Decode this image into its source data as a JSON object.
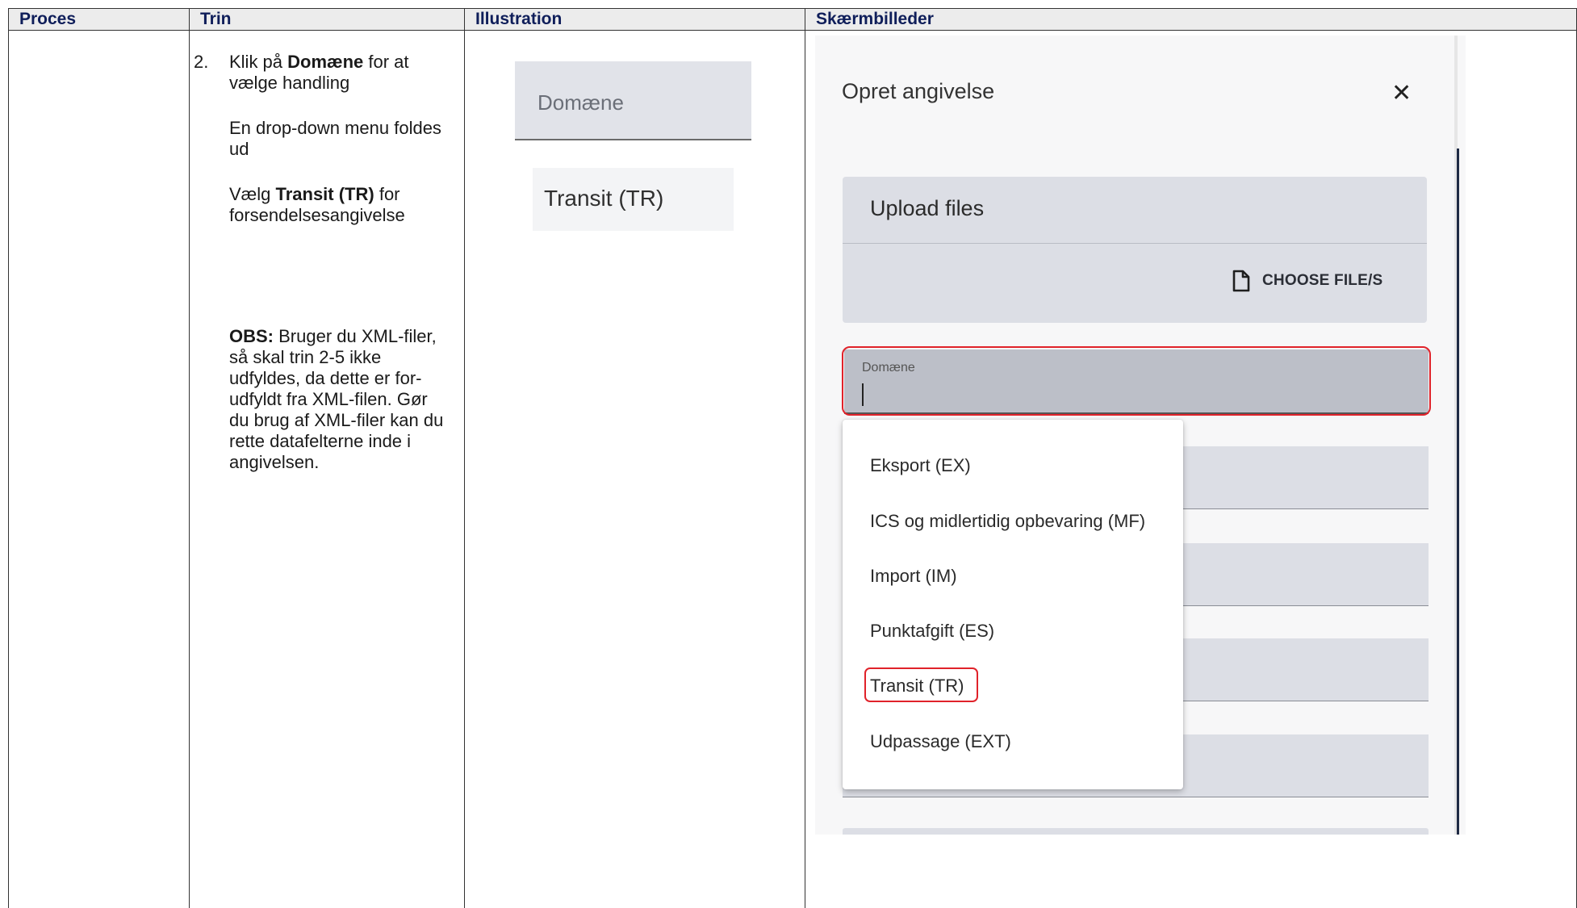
{
  "headers": {
    "proces": "Proces",
    "trin": "Trin",
    "illustration": "Illustration",
    "skaermbilleder": "Skærmbilleder"
  },
  "trin": {
    "number": "2.",
    "line1_pre": "Klik på ",
    "line1_bold": "Domæne",
    "line1_post": " for at vælge handling",
    "line2": "En drop-down menu foldes ud",
    "line3_pre": "Vælg ",
    "line3_bold": "Transit (TR)",
    "line3_post": " for forsendelsesangivelse",
    "obs_bold": "OBS:",
    "obs_text": " Bruger du XML-filer, så skal trin 2-5 ikke udfyldes, da dette er for-udfyldt fra XML-filen. Gør du brug af XML-filer kan du rette datafelterne inde i angivelsen."
  },
  "illustration": {
    "field_label": "Domæne",
    "option": "Transit (TR)"
  },
  "screenshot": {
    "dialog_title": "Opret angivelse",
    "close_icon": "close-icon",
    "upload_title": "Upload files",
    "choose_label": "CHOOSE FILE/S",
    "file_icon": "file-icon",
    "field_label": "Domæne",
    "menu_items": [
      "Eksport (EX)",
      "ICS og midlertidig opbevaring (MF)",
      "Import (IM)",
      "Punktafgift (ES)",
      "Transit (TR)",
      "Udpassage (EXT)"
    ],
    "highlight_color": "#e0222a"
  }
}
